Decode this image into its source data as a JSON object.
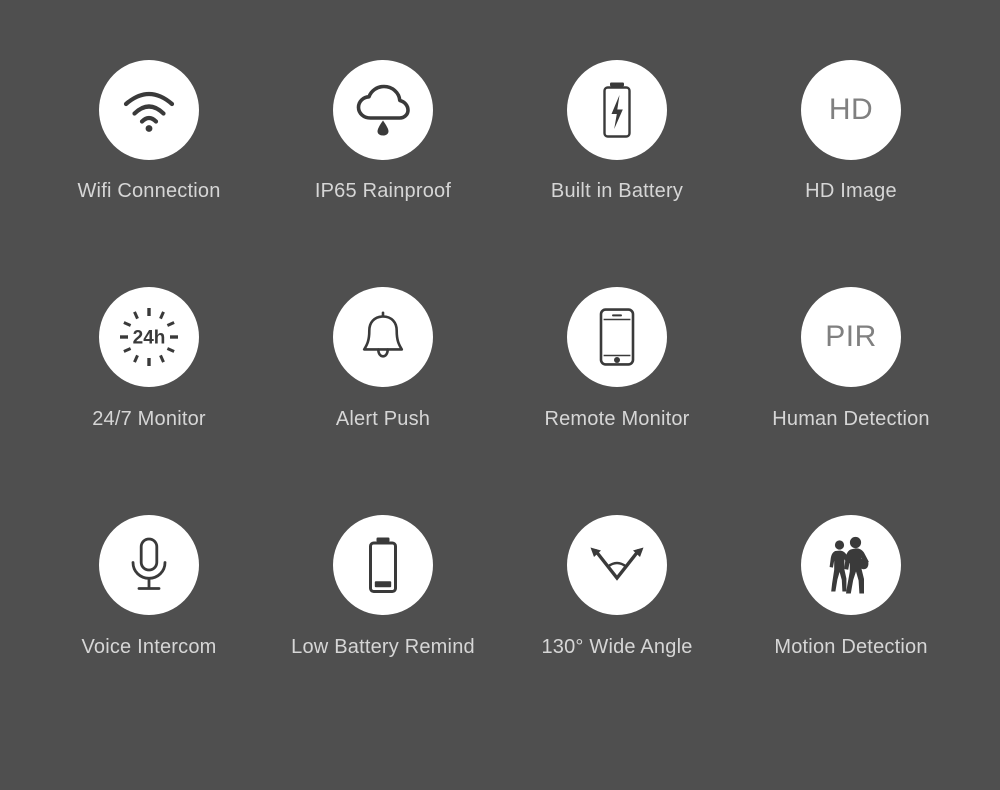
{
  "background_color": "#4f4f4f",
  "circle_color": "#ffffff",
  "label_color": "#d6d6d6",
  "icon_color": "#3a3a3a",
  "icon_text_color": "#808080",
  "grid": {
    "columns": 4,
    "rows": 3
  },
  "features": [
    {
      "label": "Wifi Connection",
      "icon": "wifi-icon",
      "icon_text": ""
    },
    {
      "label": "IP65 Rainproof",
      "icon": "cloud-rain-icon",
      "icon_text": ""
    },
    {
      "label": "Built in Battery",
      "icon": "battery-charging-icon",
      "icon_text": ""
    },
    {
      "label": "HD Image",
      "icon": "hd-text-icon",
      "icon_text": "HD"
    },
    {
      "label": "24/7 Monitor",
      "icon": "24h-sunburst-icon",
      "icon_text": "24h"
    },
    {
      "label": "Alert Push",
      "icon": "bell-icon",
      "icon_text": ""
    },
    {
      "label": "Remote Monitor",
      "icon": "smartphone-icon",
      "icon_text": ""
    },
    {
      "label": "Human Detection",
      "icon": "pir-text-icon",
      "icon_text": "PIR"
    },
    {
      "label": "Voice Intercom",
      "icon": "microphone-icon",
      "icon_text": ""
    },
    {
      "label": "Low Battery Remind",
      "icon": "battery-low-icon",
      "icon_text": ""
    },
    {
      "label": "130° Wide Angle",
      "icon": "wide-angle-icon",
      "icon_text": ""
    },
    {
      "label": "Motion Detection",
      "icon": "walking-people-icon",
      "icon_text": ""
    }
  ]
}
